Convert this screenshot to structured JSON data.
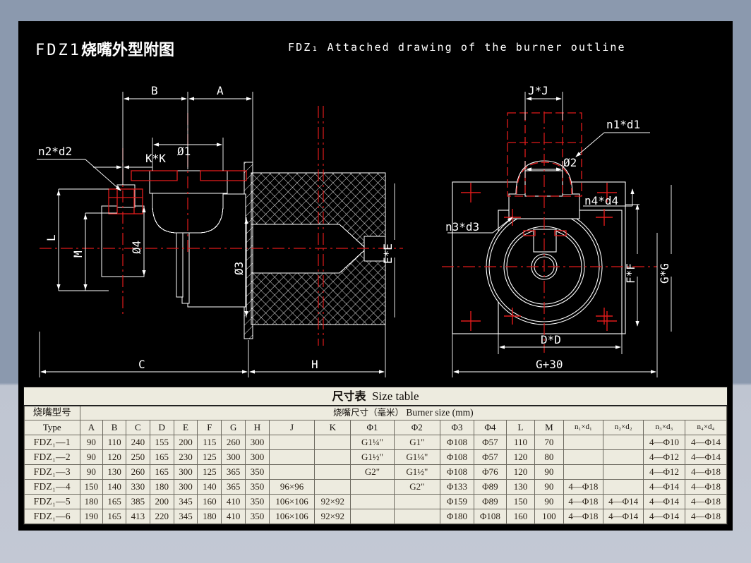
{
  "page": {
    "background_color": "#8b99ae",
    "sheet_color": "#000000",
    "line_color": "#ffffff",
    "centerline_color": "#ff0000"
  },
  "header": {
    "title_cn_latin": "FDZ1",
    "title_cn_han": "烧嘴外型附图",
    "title_en": "FDZ₁ Attached drawing of the burner outline"
  },
  "drawing": {
    "front_view_labels": [
      {
        "name": "dim-B",
        "text": "B"
      },
      {
        "name": "dim-A",
        "text": "A"
      },
      {
        "name": "dim-phi1",
        "text": "Ø1"
      },
      {
        "name": "dim-KK",
        "text": "K*K"
      },
      {
        "name": "callout-n2d2",
        "text": "n2*d2"
      },
      {
        "name": "dim-L",
        "text": "L"
      },
      {
        "name": "dim-M",
        "text": "M"
      },
      {
        "name": "dim-phi4",
        "text": "Ø4"
      },
      {
        "name": "dim-phi3",
        "text": "Ø3"
      },
      {
        "name": "dim-EE",
        "text": "E*E"
      },
      {
        "name": "dim-C",
        "text": "C"
      },
      {
        "name": "dim-H",
        "text": "H"
      }
    ],
    "side_view_labels": [
      {
        "name": "dim-JJ",
        "text": "J*J"
      },
      {
        "name": "callout-n1d1",
        "text": "n1*d1"
      },
      {
        "name": "dim-phi2",
        "text": "Ø2"
      },
      {
        "name": "callout-n3d3",
        "text": "n3*d3"
      },
      {
        "name": "callout-n4d4",
        "text": "n4*d4"
      },
      {
        "name": "dim-DD",
        "text": "D*D"
      },
      {
        "name": "dim-FF",
        "text": "F*F"
      },
      {
        "name": "dim-GG",
        "text": "G*G"
      },
      {
        "name": "dim-G30",
        "text": "G+30"
      }
    ]
  },
  "table": {
    "title_cn": "尺寸表",
    "title_en": "Size table",
    "span_header_cn": "烧嘴尺寸（毫米）",
    "span_header_en": "Burner size (mm)",
    "type_header_cn": "烧嘴型号",
    "type_header_en": "Type",
    "columns": [
      "A",
      "B",
      "C",
      "D",
      "E",
      "F",
      "G",
      "H",
      "J",
      "K",
      "Φ1",
      "Φ2",
      "Φ3",
      "Φ4",
      "L",
      "M",
      "n₁×d₁",
      "n₂×d₂",
      "n₃×d₃",
      "n₄×d₄"
    ],
    "rows": [
      {
        "model": "FDZ₁—1",
        "A": "90",
        "B": "110",
        "C": "240",
        "D": "155",
        "E": "200",
        "F": "115",
        "G": "260",
        "H": "300",
        "J": "",
        "K": "",
        "phi1": "G1¼\"",
        "phi2": "G1\"",
        "phi3": "Φ108",
        "phi4": "Φ57",
        "L": "110",
        "M": "70",
        "n1d1": "",
        "n2d2": "",
        "n3d3": "4—Φ10",
        "n4d4": "4—Φ14"
      },
      {
        "model": "FDZ₁—2",
        "A": "90",
        "B": "120",
        "C": "250",
        "D": "165",
        "E": "230",
        "F": "125",
        "G": "300",
        "H": "300",
        "J": "",
        "K": "",
        "phi1": "G1½\"",
        "phi2": "G1¼\"",
        "phi3": "Φ108",
        "phi4": "Φ57",
        "L": "120",
        "M": "80",
        "n1d1": "",
        "n2d2": "",
        "n3d3": "4—Φ12",
        "n4d4": "4—Φ14"
      },
      {
        "model": "FDZ₁—3",
        "A": "90",
        "B": "130",
        "C": "260",
        "D": "165",
        "E": "300",
        "F": "125",
        "G": "365",
        "H": "350",
        "J": "",
        "K": "",
        "phi1": "G2\"",
        "phi2": "G1½\"",
        "phi3": "Φ108",
        "phi4": "Φ76",
        "L": "120",
        "M": "90",
        "n1d1": "",
        "n2d2": "",
        "n3d3": "4—Φ12",
        "n4d4": "4—Φ18"
      },
      {
        "model": "FDZ₁—4",
        "A": "150",
        "B": "140",
        "C": "330",
        "D": "180",
        "E": "300",
        "F": "140",
        "G": "365",
        "H": "350",
        "J": "96×96",
        "K": "",
        "phi1": "",
        "phi2": "G2\"",
        "phi3": "Φ133",
        "phi4": "Φ89",
        "L": "130",
        "M": "90",
        "n1d1": "4—Φ18",
        "n2d2": "",
        "n3d3": "4—Φ14",
        "n4d4": "4—Φ18"
      },
      {
        "model": "FDZ₁—5",
        "A": "180",
        "B": "165",
        "C": "385",
        "D": "200",
        "E": "345",
        "F": "160",
        "G": "410",
        "H": "350",
        "J": "106×106",
        "K": "92×92",
        "phi1": "",
        "phi2": "",
        "phi3": "Φ159",
        "phi4": "Φ89",
        "L": "150",
        "M": "90",
        "n1d1": "4—Φ18",
        "n2d2": "4—Φ14",
        "n3d3": "4—Φ14",
        "n4d4": "4—Φ18"
      },
      {
        "model": "FDZ₁—6",
        "A": "190",
        "B": "165",
        "C": "413",
        "D": "220",
        "E": "345",
        "F": "180",
        "G": "410",
        "H": "350",
        "J": "106×106",
        "K": "92×92",
        "phi1": "",
        "phi2": "",
        "phi3": "Φ180",
        "phi4": "Φ108",
        "L": "160",
        "M": "100",
        "n1d1": "4—Φ18",
        "n2d2": "4—Φ14",
        "n3d3": "4—Φ14",
        "n4d4": "4—Φ18"
      }
    ]
  }
}
